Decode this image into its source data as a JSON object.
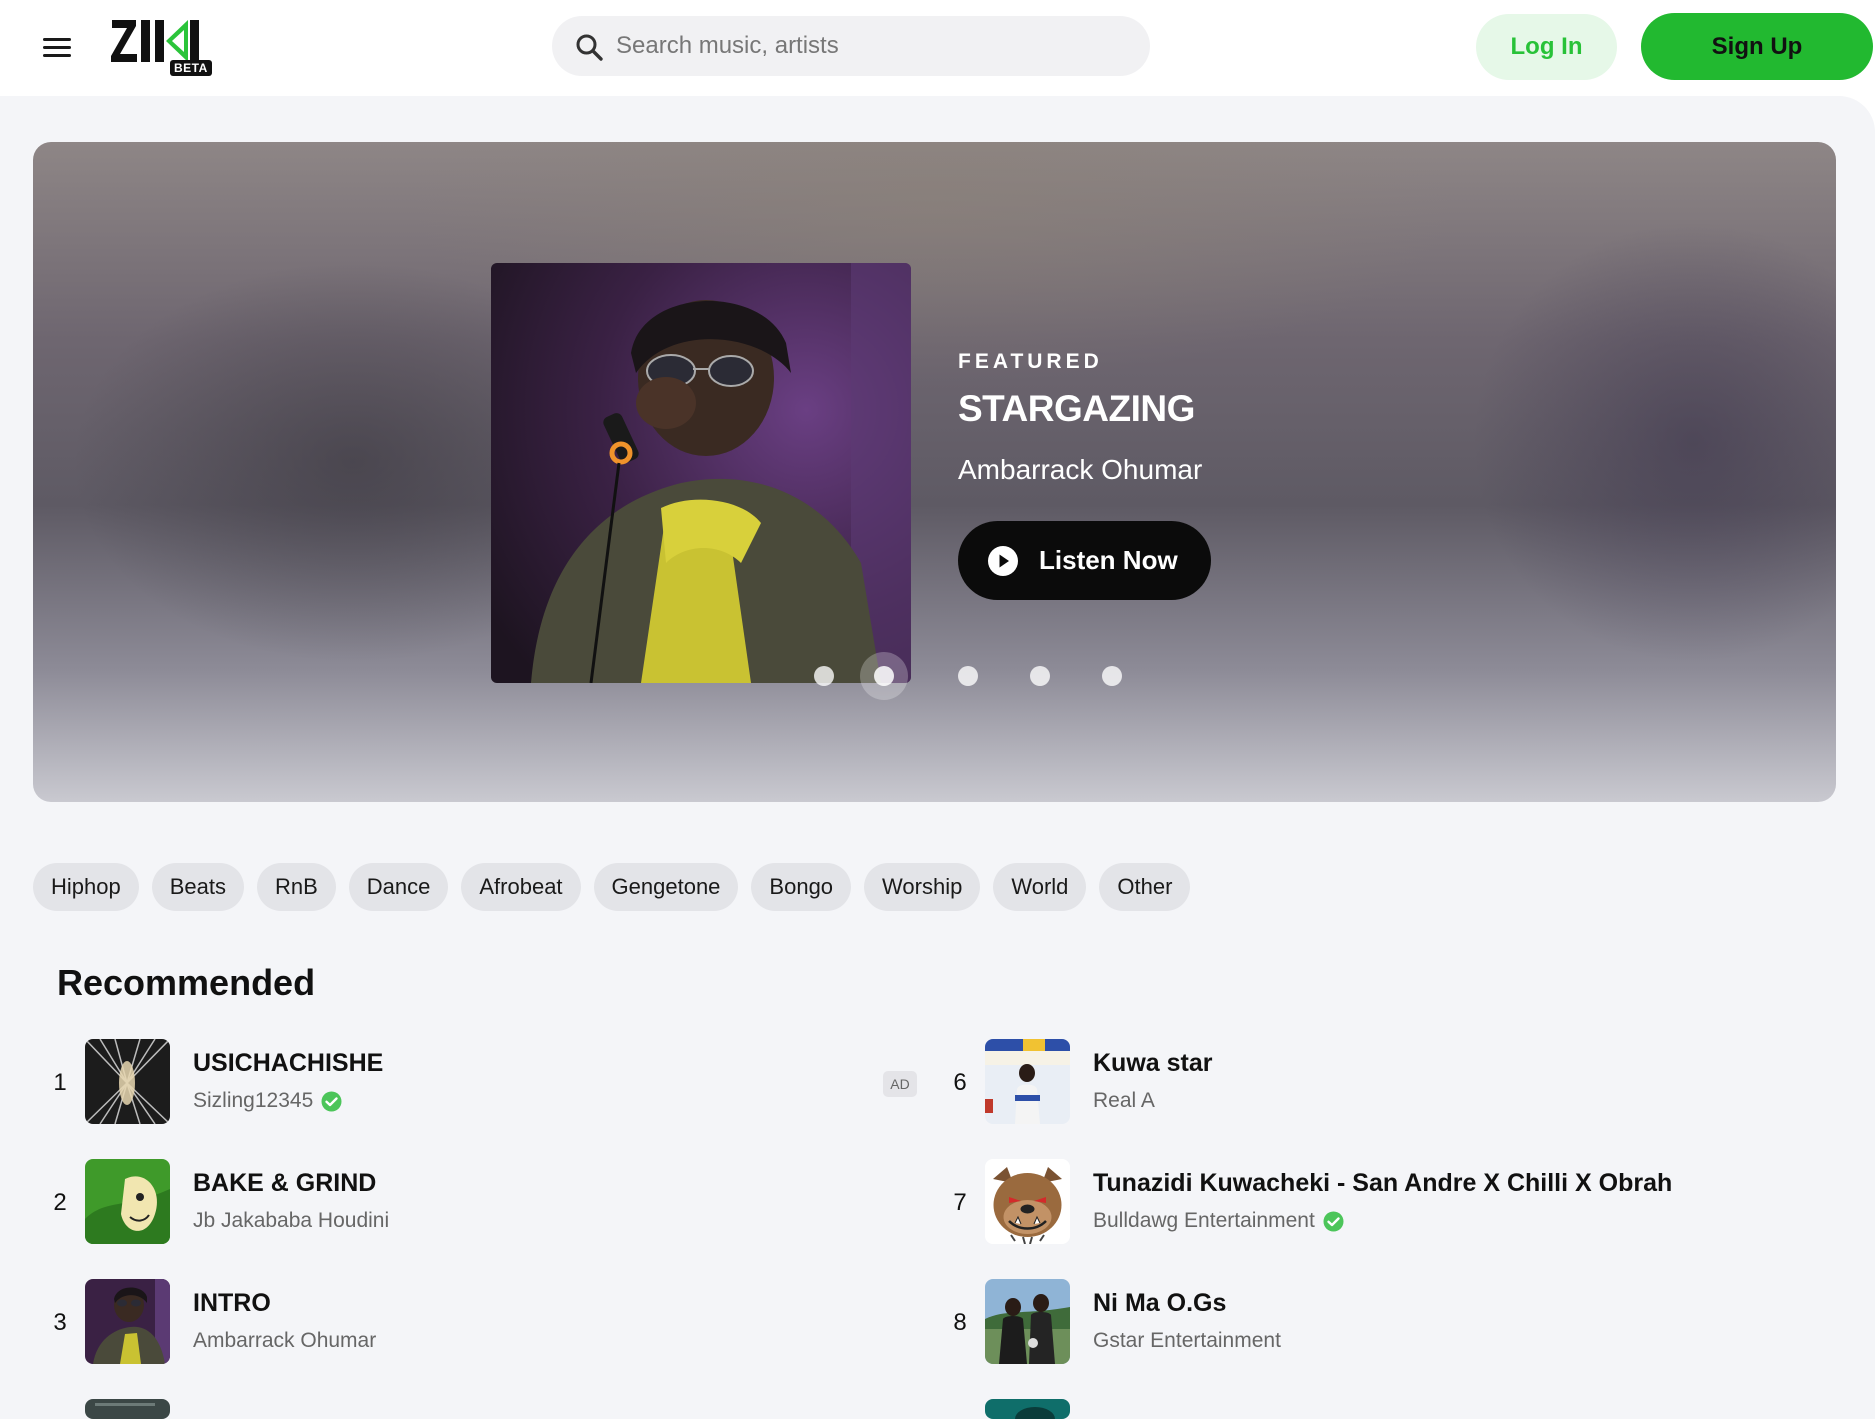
{
  "header": {
    "logo_text": "ZIKI",
    "logo_badge": "BETA",
    "search_placeholder": "Search music, artists",
    "login_label": "Log In",
    "signup_label": "Sign Up"
  },
  "hero": {
    "eyebrow": "FEATURED",
    "title": "STARGAZING",
    "artist": "Ambarrack Ohumar",
    "cta_label": "Listen Now",
    "slide_count": 5,
    "active_slide": 2
  },
  "genres": [
    "Hiphop",
    "Beats",
    "RnB",
    "Dance",
    "Afrobeat",
    "Gengetone",
    "Bongo",
    "Worship",
    "World",
    "Other"
  ],
  "recommended": {
    "title": "Recommended",
    "ad_label": "AD",
    "tracks": [
      {
        "num": "1",
        "title": "USICHACHISHE",
        "artist": "Sizling12345",
        "verified": true
      },
      {
        "num": "2",
        "title": "BAKE & GRIND",
        "artist": "Jb Jakababa Houdini",
        "verified": false
      },
      {
        "num": "3",
        "title": "INTRO",
        "artist": "Ambarrack Ohumar",
        "verified": false
      },
      {
        "num": "6",
        "title": "Kuwa star",
        "artist": "Real A",
        "verified": false
      },
      {
        "num": "7",
        "title": "Tunazidi Kuwacheki - San Andre X Chilli X Obrah",
        "artist": "Bulldawg Entertainment",
        "verified": true
      },
      {
        "num": "8",
        "title": "Ni Ma O.Gs",
        "artist": "Gstar Entertainment",
        "verified": false
      }
    ]
  },
  "colors": {
    "brand_green": "#22b930",
    "login_bg": "#e6f8e8",
    "page_bg": "#f4f5f8",
    "verified_green": "#4cc55a"
  }
}
